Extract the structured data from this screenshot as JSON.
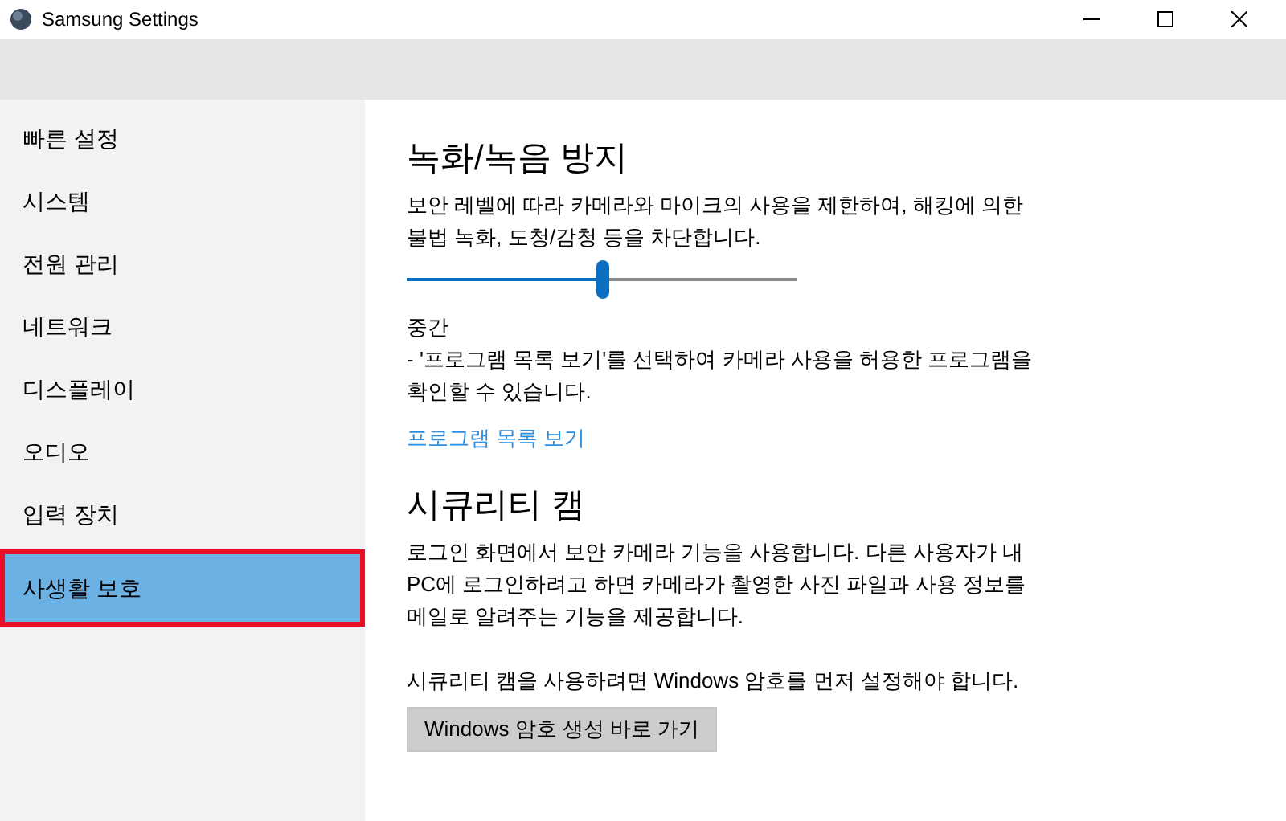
{
  "window": {
    "title": "Samsung Settings"
  },
  "sidebar": {
    "items": [
      {
        "label": "빠른 설정",
        "selected": false
      },
      {
        "label": "시스템",
        "selected": false
      },
      {
        "label": "전원 관리",
        "selected": false
      },
      {
        "label": "네트워크",
        "selected": false
      },
      {
        "label": "디스플레이",
        "selected": false
      },
      {
        "label": "오디오",
        "selected": false
      },
      {
        "label": "입력 장치",
        "selected": false
      },
      {
        "label": "사생활 보호",
        "selected": true
      }
    ]
  },
  "sections": [
    {
      "title": "녹화/녹음 방지",
      "description": "보안 레벨에 따라 카메라와 마이크의 사용을 제한하여, 해킹에 의한 불법 녹화, 도청/감청 등을 차단합니다.",
      "slider": {
        "level": 0.5
      },
      "level_name": "중간",
      "level_note": "- '프로그램 목록 보기'를 선택하여 카메라 사용을 허용한 프로그램을 확인할 수 있습니다.",
      "link": "프로그램 목록 보기"
    },
    {
      "title": "시큐리티 캠",
      "description": "로그인 화면에서 보안 카메라 기능을 사용합니다. 다른 사용자가 내 PC에 로그인하려고 하면 카메라가 촬영한 사진 파일과 사용 정보를 메일로 알려주는 기능을 제공합니다.",
      "note": "시큐리티 캠을 사용하려면 Windows 암호를 먼저 설정해야 합니다.",
      "button": "Windows 암호 생성 바로 가기"
    }
  ]
}
